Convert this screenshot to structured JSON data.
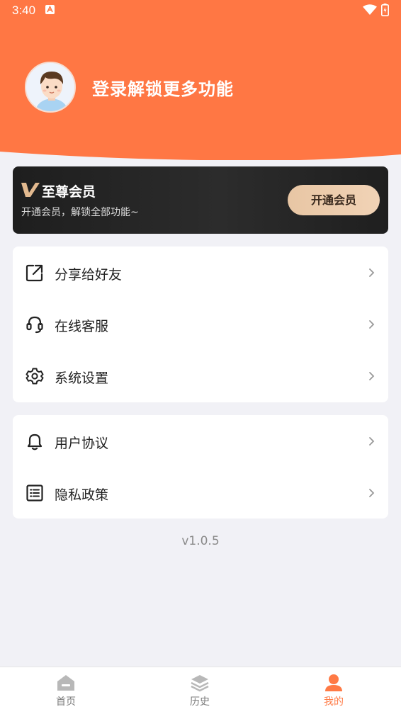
{
  "status_bar": {
    "time": "3:40"
  },
  "header": {
    "login_prompt": "登录解锁更多功能"
  },
  "vip": {
    "title": "至尊会员",
    "subtitle": "开通会员，解锁全部功能~",
    "button_label": "开通会员"
  },
  "menu_group_1": [
    {
      "label": "分享给好友",
      "icon": "share-icon"
    },
    {
      "label": "在线客服",
      "icon": "headset-icon"
    },
    {
      "label": "系统设置",
      "icon": "gear-icon"
    }
  ],
  "menu_group_2": [
    {
      "label": "用户协议",
      "icon": "bell-icon"
    },
    {
      "label": "隐私政策",
      "icon": "list-icon"
    }
  ],
  "version": "v1.0.5",
  "tabs": [
    {
      "label": "首页",
      "icon": "home-icon",
      "active": false
    },
    {
      "label": "历史",
      "icon": "layers-icon",
      "active": false
    },
    {
      "label": "我的",
      "icon": "user-icon",
      "active": true
    }
  ],
  "colors": {
    "accent": "#ff7a45",
    "vip_gold": "#e8c6a4",
    "page_bg": "#f1f1f6"
  }
}
